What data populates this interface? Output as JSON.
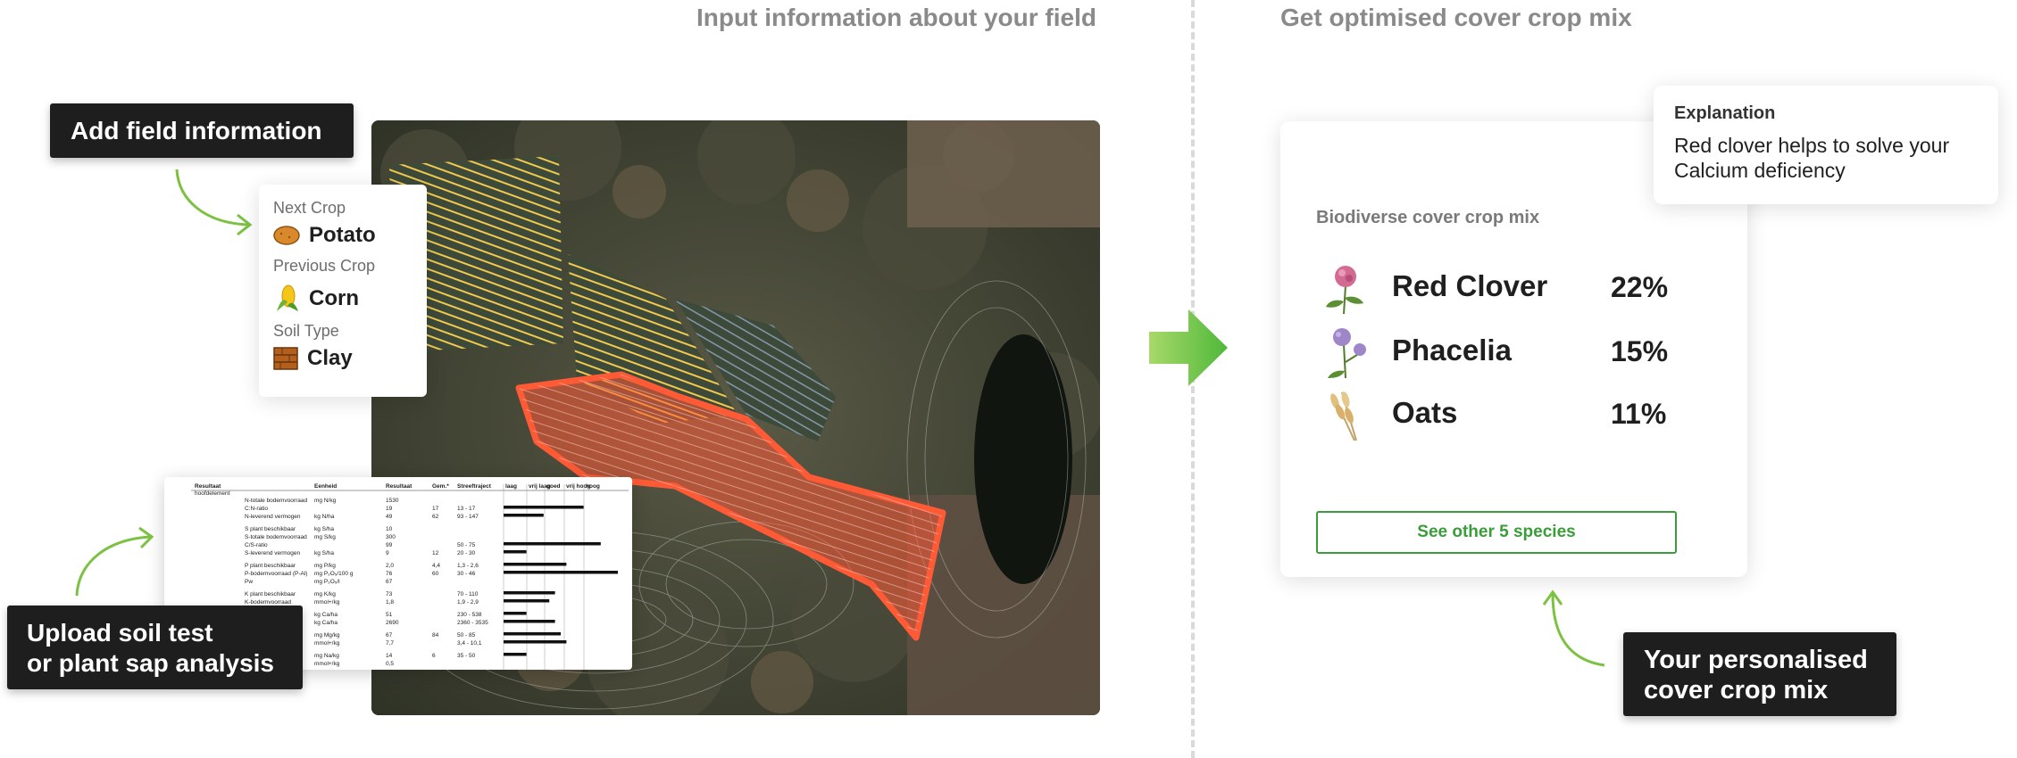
{
  "headings": {
    "input": "Input information about your field",
    "output": "Get optimised cover crop mix"
  },
  "callouts": {
    "add_field": "Add field information",
    "upload_line1": "Upload soil test",
    "upload_line2": "or plant sap analysis",
    "personalised_line1": "Your personalised",
    "personalised_line2": "cover crop mix"
  },
  "field_info": {
    "next_crop_label": "Next Crop",
    "next_crop": "Potato",
    "previous_crop_label": "Previous Crop",
    "previous_crop": "Corn",
    "soil_type_label": "Soil Type",
    "soil_type": "Clay"
  },
  "soil_report": {
    "headers": [
      "Resultaat",
      "Eenheid",
      "Resultaat",
      "Gem.*",
      "Streeftraject",
      "laag",
      "vrij laag",
      "goed",
      "vrij hoog",
      "hoog"
    ],
    "subheader": "hoofdelement",
    "rows": [
      {
        "name": "N-totale bodemvoorraad",
        "unit": "mg N/kg",
        "value": "1530",
        "avg": "",
        "target": "",
        "bar": 0
      },
      {
        "name": "C:N-ratio",
        "unit": "",
        "value": "19",
        "avg": "17",
        "target": "13 - 17",
        "bar": 0.7
      },
      {
        "name": "N-leverend vermogen",
        "unit": "kg N/ha",
        "value": "49",
        "avg": "62",
        "target": "93 - 147",
        "bar": 0.35
      },
      {
        "name": "S plant beschikbaar",
        "unit": "kg S/ha",
        "value": "10",
        "avg": "",
        "target": "",
        "bar": 0
      },
      {
        "name": "S-totale bodemvoorraad",
        "unit": "mg S/kg",
        "value": "300",
        "avg": "",
        "target": "",
        "bar": 0
      },
      {
        "name": "C/S-ratio",
        "unit": "",
        "value": "99",
        "avg": "",
        "target": "50 - 75",
        "bar": 0.85
      },
      {
        "name": "S-leverend vermogen",
        "unit": "kg S/ha",
        "value": "9",
        "avg": "12",
        "target": "20 - 30",
        "bar": 0.2
      },
      {
        "name": "P plant beschikbaar",
        "unit": "mg P/kg",
        "value": "2,0",
        "avg": "4,4",
        "target": "1,3 - 2,6",
        "bar": 0.55
      },
      {
        "name": "P-bodemvoorraad (P-Al)",
        "unit": "mg P₂O₅/100 g",
        "value": "76",
        "avg": "60",
        "target": "30 - 46",
        "bar": 1.0
      },
      {
        "name": "Pw",
        "unit": "mg P₂O₅/l",
        "value": "67",
        "avg": "",
        "target": "",
        "bar": 0
      },
      {
        "name": "K plant beschikbaar",
        "unit": "mg K/kg",
        "value": "73",
        "avg": "",
        "target": "70 - 110",
        "bar": 0.45
      },
      {
        "name": "K-bodemvoorraad",
        "unit": "mmol+/kg",
        "value": "1,8",
        "avg": "",
        "target": "1,9 - 2,9",
        "bar": 0.4
      },
      {
        "name": "",
        "unit": "kg Ca/ha",
        "value": "51",
        "avg": "",
        "target": "230 - 538",
        "bar": 0.2
      },
      {
        "name": "",
        "unit": "kg Ca/ha",
        "value": "2690",
        "avg": "",
        "target": "2360 - 3535",
        "bar": 0.45
      },
      {
        "name": "",
        "unit": "mg Mg/kg",
        "value": "67",
        "avg": "84",
        "target": "50 - 85",
        "bar": 0.5
      },
      {
        "name": "",
        "unit": "mmol+/kg",
        "value": "7,7",
        "avg": "",
        "target": "3,4 - 10,1",
        "bar": 0.55
      },
      {
        "name": "",
        "unit": "mg Na/kg",
        "value": "14",
        "avg": "6",
        "target": "35 - 50",
        "bar": 0.2
      },
      {
        "name": "",
        "unit": "mmol+/kg",
        "value": "0,5",
        "avg": "",
        "target": "",
        "bar": 0
      }
    ]
  },
  "recommendation": {
    "mix_title": "Biodiverse cover crop mix",
    "species": [
      {
        "name": "Red Clover",
        "percent": "22%",
        "icon": "red-clover-icon"
      },
      {
        "name": "Phacelia",
        "percent": "15%",
        "icon": "phacelia-icon"
      },
      {
        "name": "Oats",
        "percent": "11%",
        "icon": "oats-icon"
      }
    ],
    "see_other_button": "See other 5 species",
    "explanation_label": "Explanation",
    "explanation_text": "Red clover helps to solve your Calcium deficiency"
  },
  "colors": {
    "accent_green": "#7cc142",
    "button_green": "#3a9d3a",
    "field_highlight": "#ff5a36",
    "callout_bg": "#1e1e1e"
  }
}
